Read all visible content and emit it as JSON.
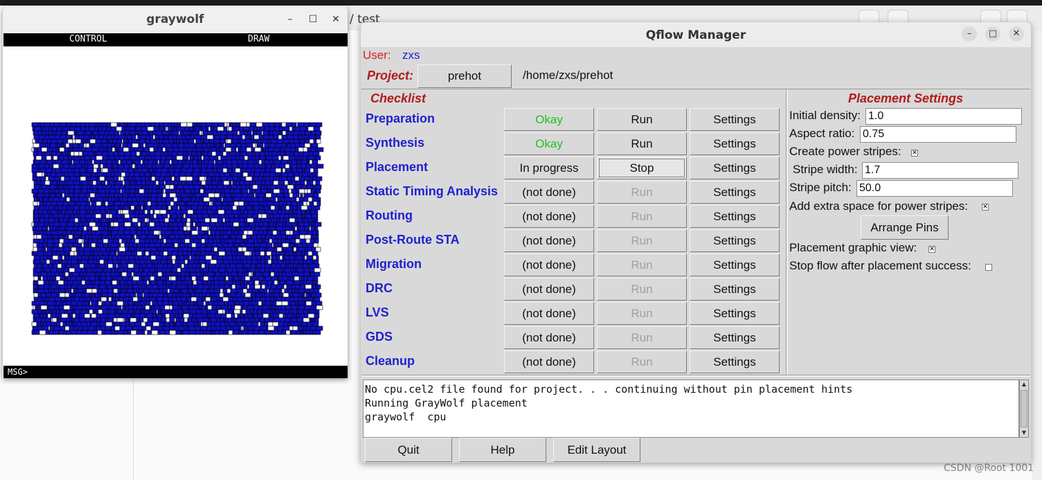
{
  "background": {
    "path_fragment": "/ test",
    "watermark": "CSDN @Root 1001"
  },
  "graywolf": {
    "title": "graywolf",
    "menu": {
      "control": "CONTROL",
      "draw": "DRAW"
    },
    "msg_prompt": "MSG>",
    "colors": {
      "cell_fill": "#1010c0",
      "cell_edge": "#000000"
    }
  },
  "qflow": {
    "title": "Qflow Manager",
    "user_label": "User:",
    "user_value": "zxs",
    "project_label": "Project:",
    "project_button": "prehot",
    "project_path": "/home/zxs/prehot",
    "checklist_title": "Checklist",
    "steps": [
      {
        "name": "Preparation",
        "status": "Okay",
        "run": "Run",
        "settings": "Settings"
      },
      {
        "name": "Synthesis",
        "status": "Okay",
        "run": "Run",
        "settings": "Settings"
      },
      {
        "name": "Placement",
        "status": "In progress",
        "run": "Stop",
        "settings": "Settings"
      },
      {
        "name": "Static Timing Analysis",
        "status": "(not done)",
        "run": "Run",
        "settings": "Settings"
      },
      {
        "name": "Routing",
        "status": "(not done)",
        "run": "Run",
        "settings": "Settings"
      },
      {
        "name": "Post-Route STA",
        "status": "(not done)",
        "run": "Run",
        "settings": "Settings"
      },
      {
        "name": "Migration",
        "status": "(not done)",
        "run": "Run",
        "settings": "Settings"
      },
      {
        "name": "DRC",
        "status": "(not done)",
        "run": "Run",
        "settings": "Settings"
      },
      {
        "name": "LVS",
        "status": "(not done)",
        "run": "Run",
        "settings": "Settings"
      },
      {
        "name": "GDS",
        "status": "(not done)",
        "run": "Run",
        "settings": "Settings"
      },
      {
        "name": "Cleanup",
        "status": "(not done)",
        "run": "Run",
        "settings": "Settings"
      }
    ],
    "placement": {
      "title": "Placement Settings",
      "initial_density_label": "Initial density:",
      "initial_density": "1.0",
      "aspect_ratio_label": "Aspect ratio:",
      "aspect_ratio": "0.75",
      "power_stripes_label": "Create power stripes:",
      "power_stripes_checked": true,
      "stripe_width_label": "Stripe width:",
      "stripe_width": "1.7",
      "stripe_pitch_label": "Stripe pitch:",
      "stripe_pitch": "50.0",
      "extra_space_label": "Add extra space for power stripes:",
      "extra_space_checked": true,
      "arrange_pins": "Arrange Pins",
      "graphic_view_label": "Placement graphic view:",
      "graphic_view_checked": true,
      "stop_after_label": "Stop flow after placement success:",
      "stop_after_checked": false
    },
    "console_lines": [
      "No cpu.cel2 file found for project. . . continuing without pin placement hints",
      "Running GrayWolf placement",
      "graywolf  cpu"
    ],
    "bottom_buttons": {
      "quit": "Quit",
      "help": "Help",
      "edit_layout": "Edit Layout"
    },
    "colors": {
      "okay": "#1ec01e",
      "step_label": "#1f1fd0",
      "heading": "#b01c1c",
      "user_label": "#d42020",
      "disabled": "#a0a0a0"
    }
  }
}
